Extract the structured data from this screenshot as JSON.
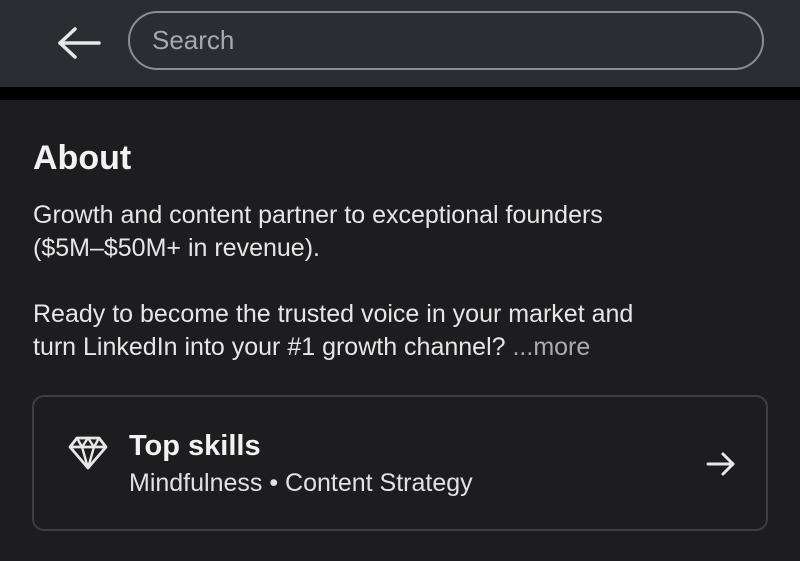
{
  "header": {
    "back_icon": "arrow-left-icon",
    "search_placeholder": "Search",
    "search_value": ""
  },
  "about": {
    "title": "About",
    "paragraph1_line1": "Growth and content partner to exceptional founders",
    "paragraph1_line2": "($5M–$50M+ in revenue).",
    "paragraph2_line1": "Ready to become the trusted voice in your market and",
    "paragraph2_line2": "turn LinkedIn into your #1 growth channel? ",
    "more_label": "...more"
  },
  "top_skills": {
    "icon": "diamond-icon",
    "title": "Top skills",
    "skills": "Mindfulness • Content Strategy",
    "arrow_icon": "arrow-right-icon"
  },
  "colors": {
    "background": "#1d1d1f",
    "topbar": "#2a2d31",
    "text": "#e6e6e6",
    "muted": "#a9acb0"
  }
}
